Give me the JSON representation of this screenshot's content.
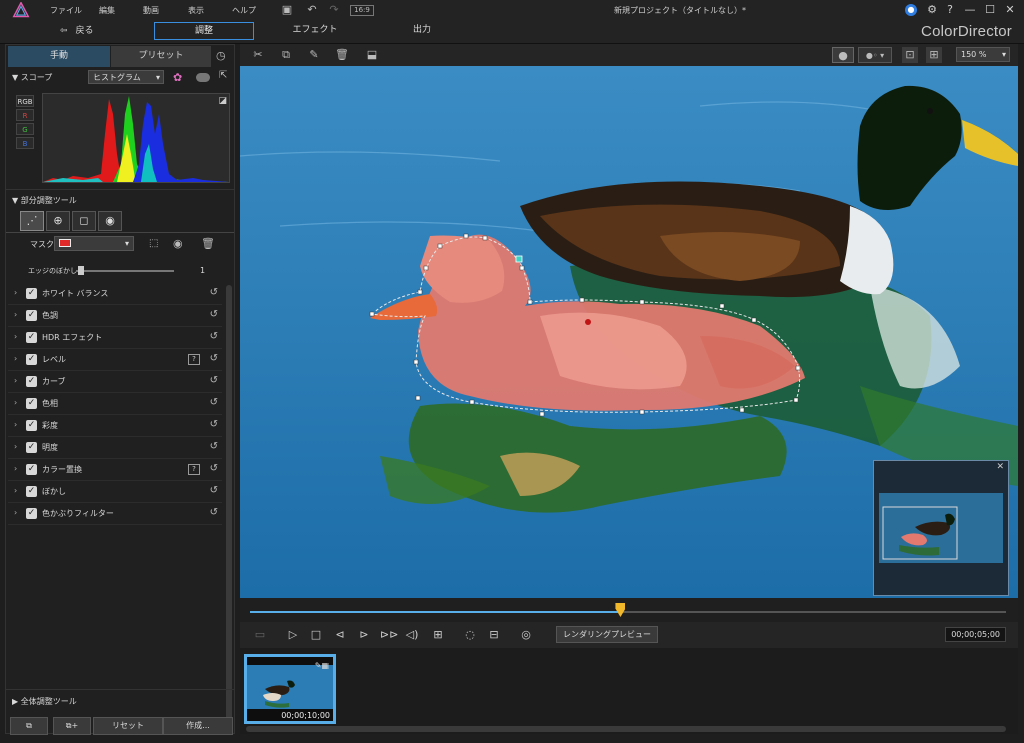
{
  "app": {
    "window_title": "新規プロジェクト（タイトルなし）*",
    "brand": "ColorDirector",
    "menu": [
      "ファイル",
      "編集",
      "動画",
      "表示",
      "ヘルプ"
    ],
    "aspect": "16:9",
    "window_controls": [
      "?",
      "—",
      "☐",
      "✕"
    ]
  },
  "modes": {
    "back_label": "戻る",
    "tabs": [
      {
        "label": "調整",
        "active": true
      },
      {
        "label": "エフェクト",
        "active": false
      },
      {
        "label": "出力",
        "active": false
      }
    ]
  },
  "left_panel": {
    "tabs": [
      {
        "label": "手動",
        "active": true
      },
      {
        "label": "プリセット",
        "active": false
      }
    ],
    "scope": {
      "title": "スコープ",
      "mode": "ヒストグラム",
      "channels": [
        "RGB",
        "R",
        "G",
        "B"
      ]
    },
    "local_tools": {
      "title": "部分調整ツール",
      "mask_label": "マスク",
      "mask_color": "#e02a2a",
      "edge_label": "エッジのぼかし",
      "edge_value": "1",
      "edge_fraction": 0.02
    },
    "items": [
      {
        "label": "ホワイト バランス",
        "help": false
      },
      {
        "label": "色調",
        "help": false
      },
      {
        "label": "HDR エフェクト",
        "help": false
      },
      {
        "label": "レベル",
        "help": true
      },
      {
        "label": "カーブ",
        "help": false
      },
      {
        "label": "色相",
        "help": false
      },
      {
        "label": "彩度",
        "help": false
      },
      {
        "label": "明度",
        "help": false
      },
      {
        "label": "カラー置換",
        "help": true
      },
      {
        "label": "ぼかし",
        "help": false
      },
      {
        "label": "色かぶりフィルター",
        "help": false
      }
    ],
    "global_tools_label": "全体調整ツール",
    "buttons": {
      "reset": "リセット",
      "create": "作成..."
    }
  },
  "viewer": {
    "zoom": "150 %",
    "playhead_fraction": 0.49
  },
  "transport": {
    "render_preview": "レンダリングプレビュー",
    "timecode": "00;00;05;00"
  },
  "clip": {
    "duration": "00;00;10;00"
  },
  "colors": {
    "accent": "#3a8fe0",
    "playhead": "#f1b82c"
  }
}
